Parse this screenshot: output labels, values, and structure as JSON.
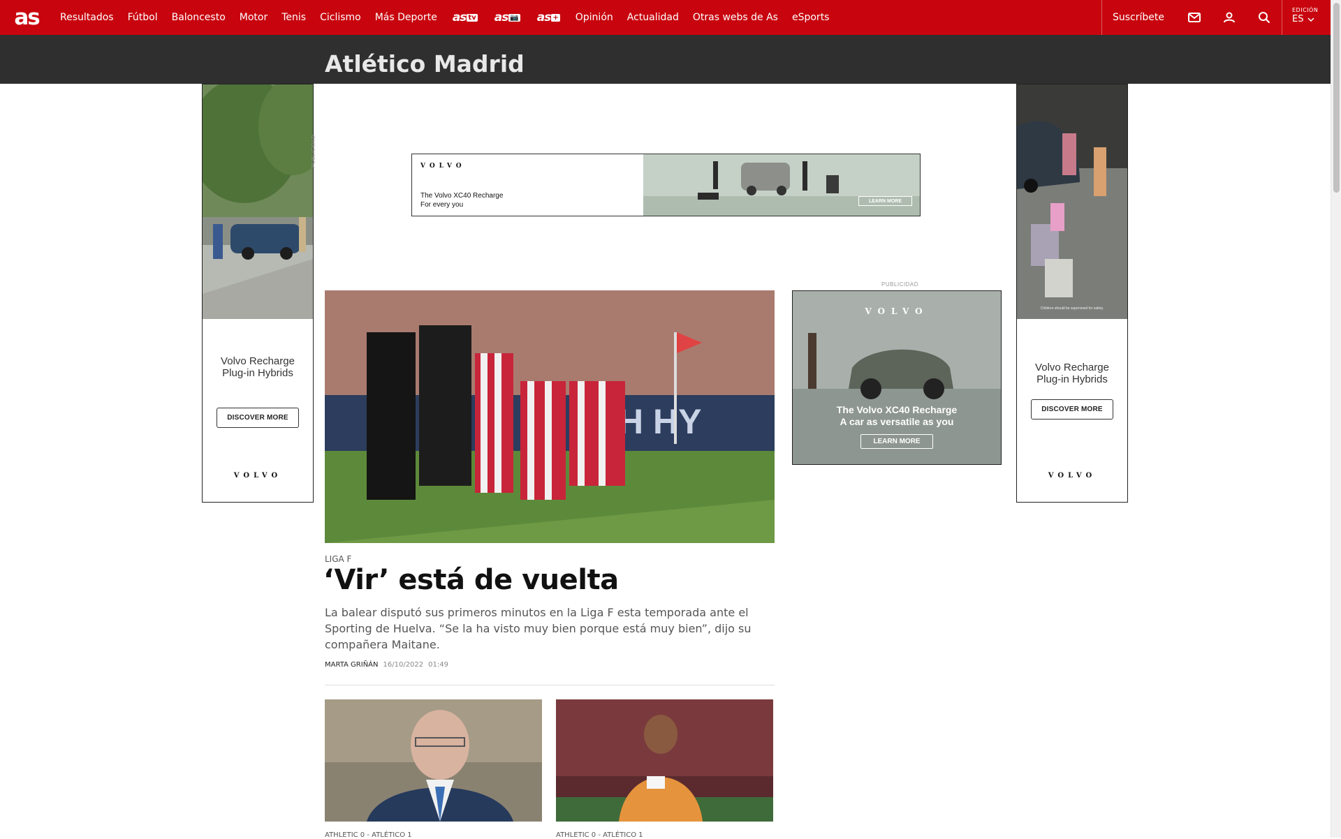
{
  "header": {
    "logo": "as",
    "nav": [
      "Resultados",
      "Fútbol",
      "Baloncesto",
      "Motor",
      "Tenis",
      "Ciclismo",
      "Más Deporte"
    ],
    "brand_links": [
      {
        "main": "as",
        "sub": "tv"
      },
      {
        "main": "as",
        "sub": "📷"
      },
      {
        "main": "as",
        "sub": "+"
      }
    ],
    "nav2": [
      "Opinión",
      "Actualidad",
      "Otras webs de As",
      "eSports"
    ],
    "subscribe": "Suscríbete",
    "edition_label": "EDICIÓN",
    "edition_value": "ES",
    "icons": [
      "mail-icon",
      "user-icon",
      "search-icon",
      "chevron-down-icon"
    ],
    "accent": "#c8050e"
  },
  "section": {
    "title": "Atlético Madrid",
    "band_color": "#2f2f2f"
  },
  "ads": {
    "publicidad": "PUBLICIDAD",
    "leaderboard": {
      "brand": "VOLVO",
      "line1": "The Volvo XC40 Recharge",
      "line2": "For every you",
      "cta": "LEARN MORE"
    },
    "sky_left": {
      "line1": "Volvo Recharge",
      "line2": "Plug-in Hybrids",
      "cta": "DISCOVER MORE",
      "brand": "VOLVO"
    },
    "sky_right": {
      "line1": "Volvo Recharge",
      "line2": "Plug-in Hybrids",
      "cta": "DISCOVER MORE",
      "brand": "VOLVO",
      "note": "Children should be supervised for safety."
    },
    "mpu": {
      "label": "PUBLICIDAD",
      "brand": "VOLVO",
      "line1": "The Volvo XC40 Recharge",
      "line2": "A car as versatile as you",
      "cta": "LEARN MORE"
    }
  },
  "main_article": {
    "kicker": "LIGA F",
    "headline": "‘Vir’ está de vuelta",
    "summary": "La balear disputó sus primeros minutos en la Liga F esta temporada ante el Sporting de Huelva. “Se la ha visto muy bien porque está muy bien”, dijo su compañera Maitane.",
    "author": "MARTA GRIÑÁN",
    "date": "16/10/2022",
    "time": "01:49"
  },
  "cards": [
    {
      "kicker": "ATHLETIC 0 - ATLÉTICO 1"
    },
    {
      "kicker": "ATHLETIC 0 - ATLÉTICO 1"
    }
  ]
}
